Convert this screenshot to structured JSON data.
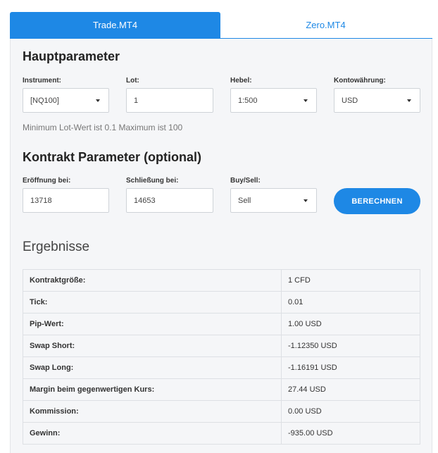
{
  "tabs": [
    {
      "label": "Trade.MT4",
      "active": true
    },
    {
      "label": "Zero.MT4",
      "active": false
    }
  ],
  "main_params": {
    "heading": "Hauptparameter",
    "instrument": {
      "label": "Instrument:",
      "value": "[NQ100]"
    },
    "lot": {
      "label": "Lot:",
      "value": "1"
    },
    "leverage": {
      "label": "Hebel:",
      "value": "1:500"
    },
    "currency": {
      "label": "Kontowährung:",
      "value": "USD"
    },
    "hint": "Minimum Lot-Wert ist 0.1 Maximum ist 100"
  },
  "contract_params": {
    "heading": "Kontrakt Parameter (optional)",
    "open": {
      "label": "Eröffnung bei:",
      "value": "13718"
    },
    "close": {
      "label": "Schließung bei:",
      "value": "14653"
    },
    "direction": {
      "label": "Buy/Sell:",
      "value": "Sell"
    },
    "calculate_label": "BERECHNEN"
  },
  "results": {
    "heading": "Ergebnisse",
    "rows": [
      {
        "key": "Kontraktgröße:",
        "value": "1 CFD"
      },
      {
        "key": "Tick:",
        "value": "0.01"
      },
      {
        "key": "Pip-Wert:",
        "value": "1.00 USD"
      },
      {
        "key": "Swap Short:",
        "value": "-1.12350 USD"
      },
      {
        "key": "Swap Long:",
        "value": "-1.16191 USD"
      },
      {
        "key": "Margin beim gegenwertigen Kurs:",
        "value": "27.44 USD"
      },
      {
        "key": "Kommission:",
        "value": "0.00 USD"
      },
      {
        "key": "Gewinn:",
        "value": "-935.00 USD"
      }
    ]
  },
  "colors": {
    "accent": "#1e88e5",
    "panel": "#f5f6f8"
  }
}
